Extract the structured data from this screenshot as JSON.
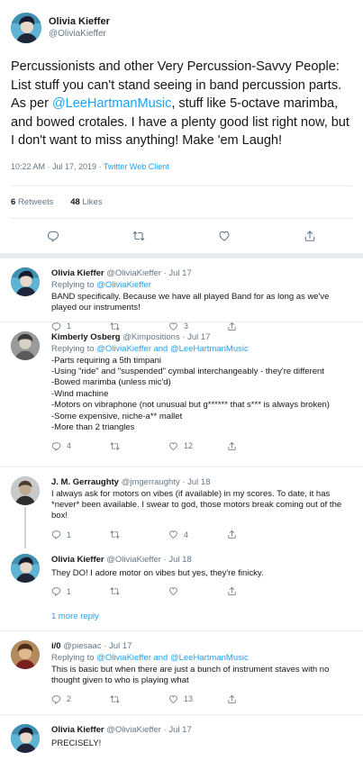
{
  "main_tweet": {
    "name": "Olivia Kieffer",
    "handle": "@OliviaKieffer",
    "text_before": "Percussionists and other Very Percussion-Savvy People: List stuff you can't stand seeing in band percussion parts. As per ",
    "mention": "@LeeHartmanMusic",
    "text_after": ", stuff like 5-octave marimba, and bowed crotales. I have a plenty good list right now, but I don't want to miss anything! Make 'em Laugh!",
    "time": "10:22 AM · Jul 17, 2019 · ",
    "client": "Twitter Web Client",
    "retweets_count": "6",
    "retweets_label": "Retweets",
    "likes_count": "48",
    "likes_label": "Likes"
  },
  "replies": [
    {
      "name": "Olivia Kieffer",
      "handle": "@OliviaKieffer · Jul 17",
      "replying_prefix": "Replying to ",
      "replying_to": "@OliviaKieffer",
      "text": "BAND specifically. Because we have all played Band for as long as we've played our instruments!",
      "replies": "1",
      "retweets": "",
      "likes": "3"
    },
    {
      "name": "Kimberly Osberg",
      "handle": "@Kimpositions · Jul 17",
      "replying_prefix": "Replying to ",
      "replying_to": "@OliviaKieffer and @LeeHartmanMusic",
      "text": "-Parts requiring a 5th timpani\n-Using \"ride\" and \"suspended\" cymbal interchangeably - they're different\n-Bowed marimba (unless mic'd)\n-Wind machine\n-Motors on vibraphone (not unusual but g****** that s*** is always broken)\n-Some expensive, niche-a** mallet\n-More than 2 triangles",
      "replies": "4",
      "retweets": "",
      "likes": "12"
    },
    {
      "name": "J. M. Gerraughty",
      "handle": "@jmgerraughty · Jul 18",
      "replying_prefix": "",
      "replying_to": "",
      "text": "I always ask for motors on vibes (if available) in my scores. To date, it has *never* been available. I swear to god, those motors break coming out of the box!",
      "replies": "1",
      "retweets": "",
      "likes": "4"
    },
    {
      "name": "Olivia Kieffer",
      "handle": "@OliviaKieffer · Jul 18",
      "replying_prefix": "",
      "replying_to": "",
      "text": "They DO! I adore motor on vibes but yes, they're finicky.",
      "replies": "1",
      "retweets": "",
      "likes": ""
    },
    {
      "name": "i/0",
      "handle": "@piesaac · Jul 17",
      "replying_prefix": "Replying to ",
      "replying_to": "@OliviaKieffer and @LeeHartmanMusic",
      "text": "This is basic but when there are just a bunch of instrument staves with no thought given to who is playing what",
      "replies": "2",
      "retweets": "",
      "likes": "13"
    },
    {
      "name": "Olivia Kieffer",
      "handle": "@OliviaKieffer · Jul 17",
      "replying_prefix": "",
      "replying_to": "",
      "text": "PRECISELY!",
      "replies": "",
      "retweets": "",
      "likes": ""
    }
  ],
  "more_replies_label": "1 more reply",
  "icons": {
    "reply": "reply-icon",
    "retweet": "retweet-icon",
    "like": "heart-icon",
    "share": "share-icon"
  },
  "colors": {
    "link": "#1da1f2",
    "muted": "#657786",
    "divider": "#e6ecf0"
  }
}
